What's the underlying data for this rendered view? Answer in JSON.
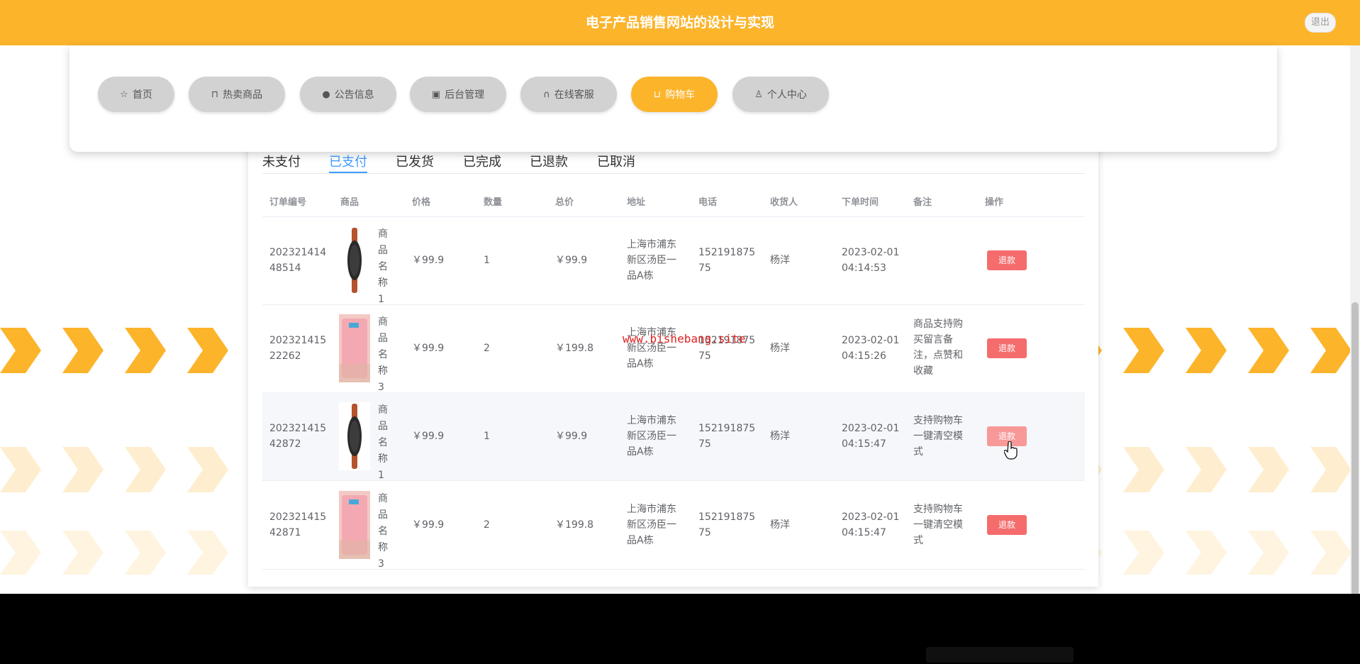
{
  "header": {
    "title": "电子产品销售网站的设计与实现",
    "logout_label": "退出"
  },
  "nav": {
    "items": [
      {
        "label": "首页",
        "icon": "star-icon",
        "glyph": "☆"
      },
      {
        "label": "热卖商品",
        "icon": "bag-icon",
        "glyph": "⊓"
      },
      {
        "label": "公告信息",
        "icon": "info-icon",
        "glyph": "●"
      },
      {
        "label": "后台管理",
        "icon": "box-icon",
        "glyph": "▣"
      },
      {
        "label": "在线客服",
        "icon": "headset-icon",
        "glyph": "∩"
      },
      {
        "label": "购物车",
        "icon": "cart-icon",
        "glyph": "⊔"
      },
      {
        "label": "个人中心",
        "icon": "user-icon",
        "glyph": "♙"
      }
    ],
    "active": "购物车"
  },
  "tabs": {
    "items": [
      "未支付",
      "已支付",
      "已发货",
      "已完成",
      "已退款",
      "已取消"
    ],
    "active": "已支付"
  },
  "table": {
    "columns": [
      "订单编号",
      "商品",
      "价格",
      "数量",
      "总价",
      "地址",
      "电话",
      "收货人",
      "下单时间",
      "备注",
      "操作"
    ],
    "rows": [
      {
        "order_no": [
          "202321414",
          "48514"
        ],
        "product_image": "watch",
        "product_name": [
          "商",
          "品",
          "名",
          "称1"
        ],
        "price": "￥99.9",
        "qty": "1",
        "total": "￥99.9",
        "address": [
          "上海市浦东",
          "新区汤臣一",
          "品A栋"
        ],
        "phone": [
          "152191875",
          "75"
        ],
        "receiver": "杨洋",
        "time": [
          "2023-02-01",
          "04:14:53"
        ],
        "note": [],
        "action": "退款"
      },
      {
        "order_no": [
          "202321415",
          "22262"
        ],
        "product_image": "pink-scale",
        "product_name": [
          "商",
          "品",
          "名",
          "称3"
        ],
        "price": "￥99.9",
        "qty": "2",
        "total": "￥199.8",
        "address": [
          "上海市浦东",
          "新区汤臣一",
          "品A栋"
        ],
        "phone": [
          "152191875",
          "75"
        ],
        "receiver": "杨洋",
        "time": [
          "2023-02-01",
          "04:15:26"
        ],
        "note": [
          "商品支持购",
          "买留言备",
          "注，点赞和",
          "收藏"
        ],
        "action": "退款"
      },
      {
        "order_no": [
          "202321415",
          "42872"
        ],
        "product_image": "watch",
        "product_name": [
          "商",
          "品",
          "名",
          "称1"
        ],
        "price": "￥99.9",
        "qty": "1",
        "total": "￥99.9",
        "address": [
          "上海市浦东",
          "新区汤臣一",
          "品A栋"
        ],
        "phone": [
          "152191875",
          "75"
        ],
        "receiver": "杨洋",
        "time": [
          "2023-02-01",
          "04:15:47"
        ],
        "note": [
          "支持购物车",
          "一键清空模",
          "式"
        ],
        "action": "退款"
      },
      {
        "order_no": [
          "202321415",
          "42871"
        ],
        "product_image": "pink-scale",
        "product_name": [
          "商",
          "品",
          "名",
          "称3"
        ],
        "price": "￥99.9",
        "qty": "2",
        "total": "￥199.8",
        "address": [
          "上海市浦东",
          "新区汤臣一",
          "品A栋"
        ],
        "phone": [
          "152191875",
          "75"
        ],
        "receiver": "杨洋",
        "time": [
          "2023-02-01",
          "04:15:47"
        ],
        "note": [
          "支持购物车",
          "一键清空模",
          "式"
        ],
        "action": "退款"
      }
    ]
  },
  "watermark": "www.bishebang.site",
  "colors": {
    "accent": "#fcb42b",
    "tab_active": "#409eff",
    "danger": "#f56c6c"
  }
}
